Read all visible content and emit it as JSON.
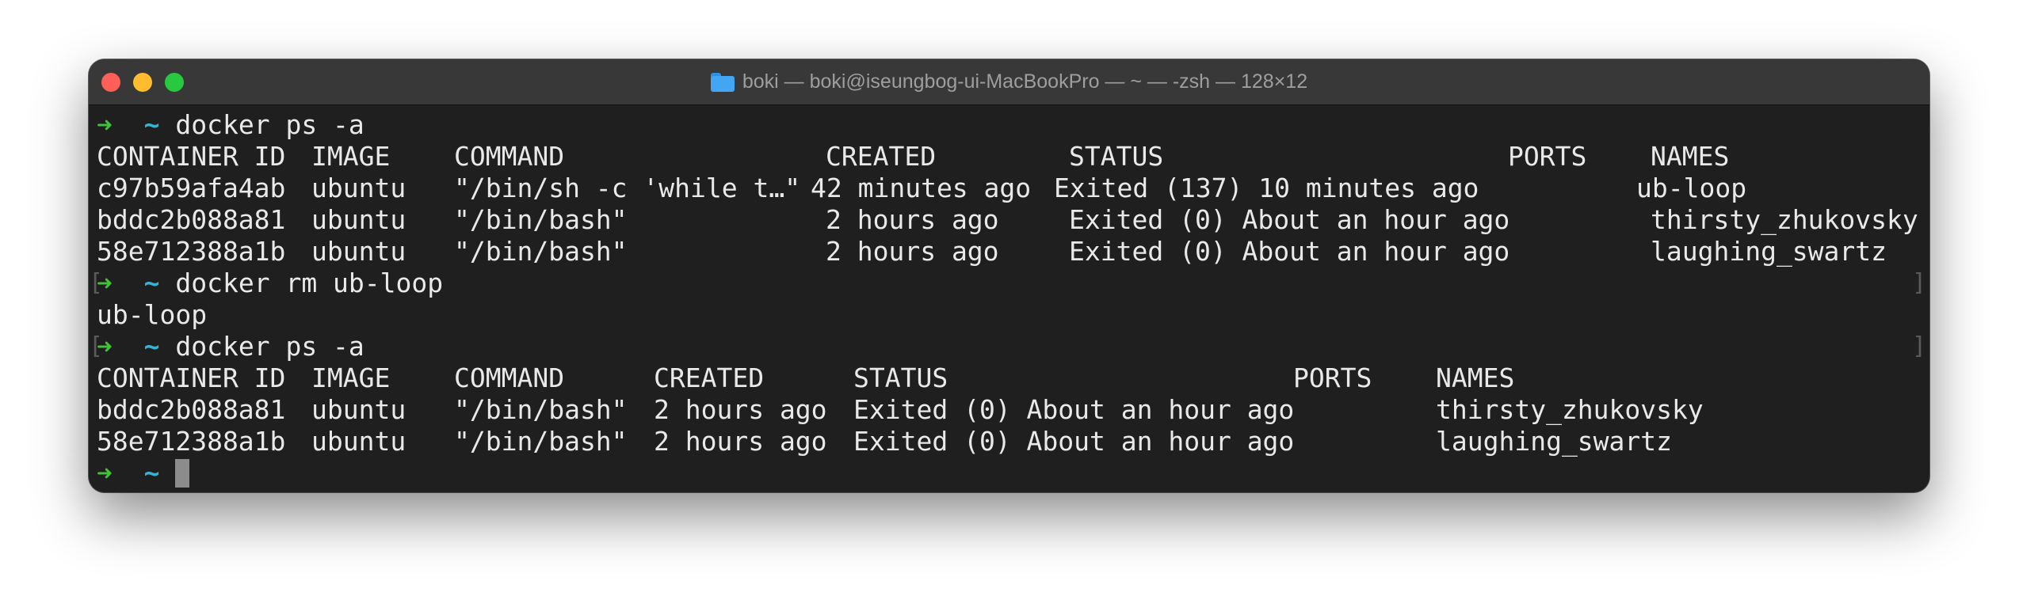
{
  "window": {
    "title": "boki — boki@iseungbog-ui-MacBookPro — ~ — -zsh — 128×12",
    "folder_icon": "folder-icon",
    "traffic_lights": {
      "close": "#fe5f57",
      "minimize": "#febc2e",
      "maximize": "#28c840"
    }
  },
  "prompt": {
    "arrow": "➜",
    "dir": "~"
  },
  "colors": {
    "background": "#1f1f1f",
    "text": "#e9e9e9",
    "arrow": "#3fc138",
    "dir": "#37b4d4"
  },
  "session": {
    "cmd1": "docker ps -a",
    "table1": {
      "headers": [
        "CONTAINER ID",
        "IMAGE",
        "COMMAND",
        "CREATED",
        "STATUS",
        "PORTS",
        "NAMES"
      ],
      "rows": [
        [
          "c97b59afa4ab",
          "ubuntu",
          "\"/bin/sh -c 'while t…\"",
          "42 minutes ago",
          "Exited (137) 10 minutes ago",
          "",
          "ub-loop"
        ],
        [
          "bddc2b088a81",
          "ubuntu",
          "\"/bin/bash\"",
          "2 hours ago",
          "Exited (0) About an hour ago",
          "",
          "thirsty_zhukovsky"
        ],
        [
          "58e712388a1b",
          "ubuntu",
          "\"/bin/bash\"",
          "2 hours ago",
          "Exited (0) About an hour ago",
          "",
          "laughing_swartz"
        ]
      ]
    },
    "cmd2": "docker rm ub-loop",
    "cmd2_output": "ub-loop",
    "cmd3": "docker ps -a",
    "table2": {
      "headers": [
        "CONTAINER ID",
        "IMAGE",
        "COMMAND",
        "CREATED",
        "STATUS",
        "PORTS",
        "NAMES"
      ],
      "rows": [
        [
          "bddc2b088a81",
          "ubuntu",
          "\"/bin/bash\"",
          "2 hours ago",
          "Exited (0) About an hour ago",
          "",
          "thirsty_zhukovsky"
        ],
        [
          "58e712388a1b",
          "ubuntu",
          "\"/bin/bash\"",
          "2 hours ago",
          "Exited (0) About an hour ago",
          "",
          "laughing_swartz"
        ]
      ]
    }
  }
}
